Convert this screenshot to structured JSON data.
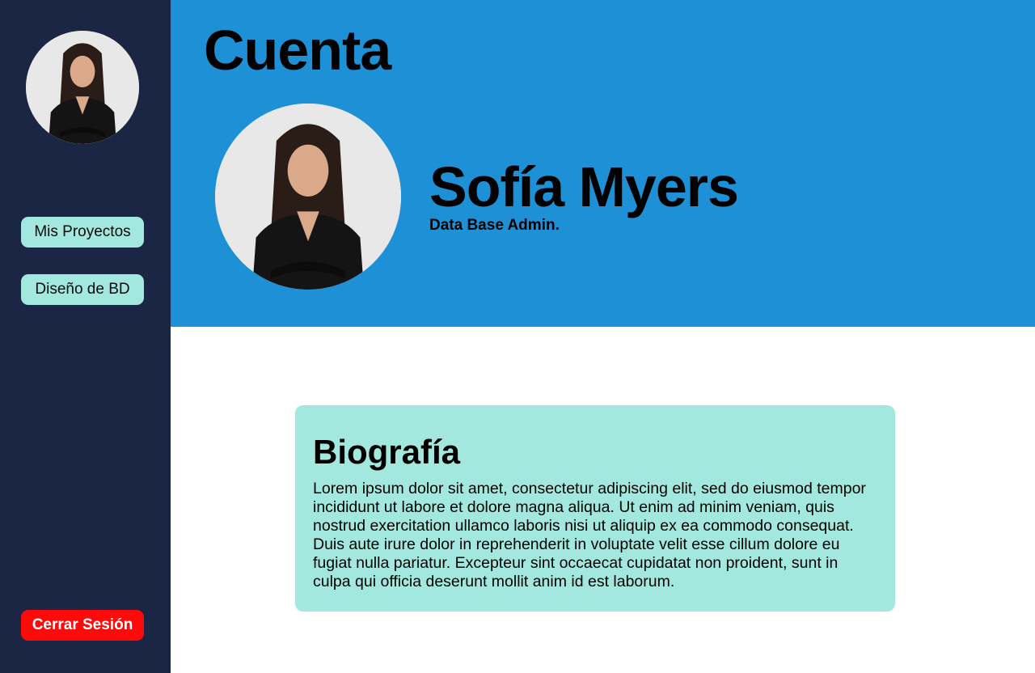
{
  "sidebar": {
    "avatar_alt": "profile photo",
    "nav": [
      {
        "label": "Mis Proyectos"
      },
      {
        "label": "Diseño de BD"
      }
    ],
    "logout_label": "Cerrar Sesión"
  },
  "header": {
    "title": "Cuenta",
    "name": "Sofía Myers",
    "role": "Data Base Admin."
  },
  "bio": {
    "title": "Biografía",
    "text": "Lorem ipsum dolor sit amet, consectetur adipiscing elit, sed do eiusmod tempor incididunt ut labore et dolore magna aliqua. Ut enim ad minim veniam, quis nostrud exercitation ullamco laboris nisi ut aliquip ex ea commodo consequat. Duis aute irure dolor in reprehenderit in voluptate velit esse cillum dolore eu fugiat nulla pariatur. Excepteur sint occaecat cupidatat non proident, sunt in culpa qui officia deserunt mollit anim id est laborum."
  },
  "colors": {
    "sidebar_bg": "#1b2644",
    "header_bg": "#1e90d6",
    "accent": "#a2e8de",
    "logout": "#ff0a0a"
  },
  "icons": {
    "avatar": "person-photo-icon"
  }
}
